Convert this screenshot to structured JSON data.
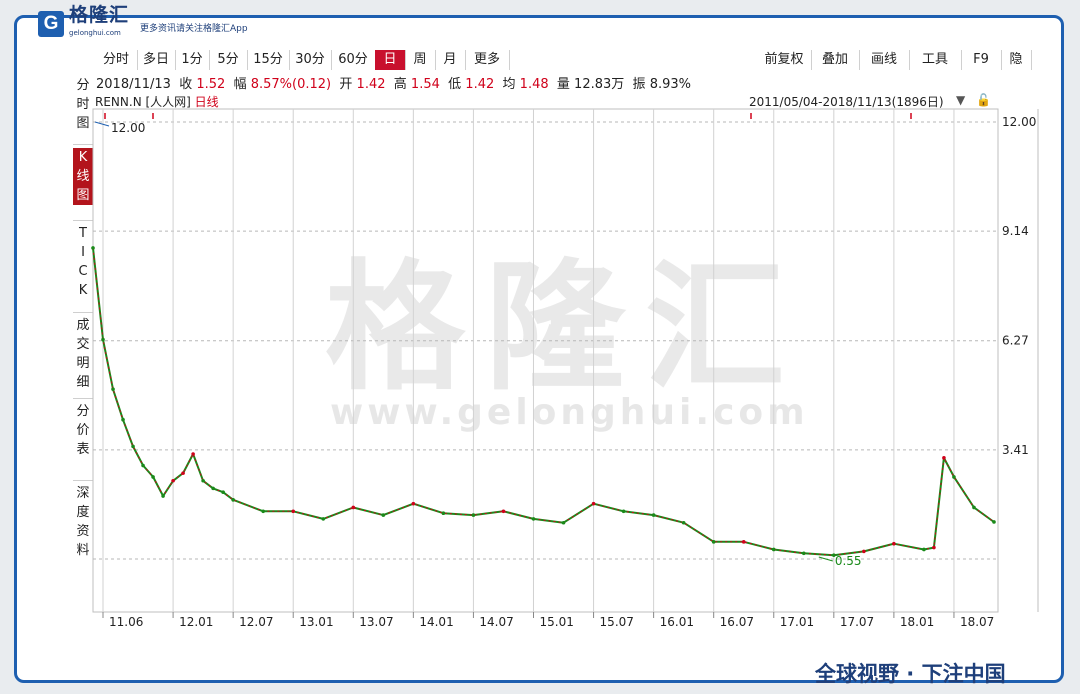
{
  "brand": {
    "logo_letter": "G",
    "name": "格隆汇",
    "domain": "gelonghui.com",
    "tagline": "更多资讯请关注格隆汇App",
    "watermark": "格隆汇",
    "watermark_url": "www.gelonghui.com",
    "footer": "全球视野 · 下注中国",
    "accent_color": "#1e5fb0"
  },
  "toolbar": {
    "periods": [
      "分时",
      "多日",
      "1分",
      "5分",
      "15分",
      "30分",
      "60分",
      "日",
      "周",
      "月",
      "更多"
    ],
    "active_period": "日",
    "tools": [
      "前复权",
      "叠加",
      "画线",
      "工具",
      "F9",
      "隐"
    ]
  },
  "info_bar": {
    "date": "2018/11/13",
    "close_label": "收",
    "close": "1.52",
    "change_label": "幅",
    "change": "8.57%(0.12)",
    "open_label": "开",
    "open": "1.42",
    "high_label": "高",
    "high": "1.54",
    "low_label": "低",
    "low": "1.42",
    "avg_label": "均",
    "avg": "1.48",
    "volume_label": "量",
    "volume": "12.83万",
    "amplitude_label": "振",
    "amplitude": "8.93%"
  },
  "side_tabs": [
    "分时图",
    "K线图",
    "TICK",
    "成交明细",
    "分价表",
    "深度资料"
  ],
  "side_tabs_active": 1,
  "chart_header": {
    "ticker": "RENN.N [人人网]",
    "period_label": "日线",
    "range": "2011/05/04-2018/11/13(1896日)"
  },
  "chart_data": {
    "type": "line",
    "ticker": "RENN.N",
    "y_ticks": [
      "12.00",
      "9.14",
      "6.27",
      "3.41"
    ],
    "ylim": [
      0.55,
      12.0
    ],
    "x_ticks": [
      "11.06",
      "12.01",
      "12.07",
      "13.01",
      "13.07",
      "14.01",
      "14.07",
      "15.01",
      "15.07",
      "16.01",
      "16.07",
      "17.01",
      "17.07",
      "18.01",
      "18.07"
    ],
    "annotations": {
      "max": "12.00",
      "min": "0.55"
    },
    "series": [
      {
        "up_color": "#d0021b",
        "down_color": "#1a8a1a",
        "x": [
          "11.05",
          "11.06",
          "11.07",
          "11.08",
          "11.09",
          "11.10",
          "11.11",
          "11.12",
          "12.01",
          "12.02",
          "12.03",
          "12.04",
          "12.05",
          "12.06",
          "12.07",
          "12.10",
          "13.01",
          "13.04",
          "13.07",
          "13.10",
          "14.01",
          "14.04",
          "14.07",
          "14.10",
          "15.01",
          "15.04",
          "15.07",
          "15.10",
          "16.01",
          "16.04",
          "16.07",
          "16.10",
          "17.01",
          "17.04",
          "17.07",
          "17.10",
          "18.01",
          "18.04",
          "18.05",
          "18.06",
          "18.07",
          "18.09",
          "18.11"
        ],
        "values": [
          8.7,
          6.3,
          5.0,
          4.2,
          3.5,
          3.0,
          2.7,
          2.2,
          2.6,
          2.8,
          3.3,
          2.6,
          2.4,
          2.3,
          2.1,
          1.8,
          1.8,
          1.6,
          1.9,
          1.7,
          2.0,
          1.75,
          1.7,
          1.8,
          1.6,
          1.5,
          2.0,
          1.8,
          1.7,
          1.5,
          1.0,
          1.0,
          0.8,
          0.7,
          0.65,
          0.75,
          0.95,
          0.8,
          0.85,
          3.2,
          2.7,
          1.9,
          1.52
        ]
      }
    ]
  }
}
